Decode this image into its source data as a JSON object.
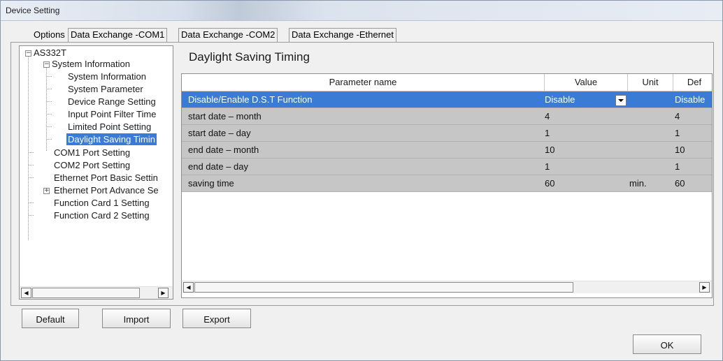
{
  "window": {
    "title": "Device Setting"
  },
  "tabs": [
    {
      "label": "Options"
    },
    {
      "label": "Data Exchange -COM1"
    },
    {
      "label": "Data Exchange -COM2"
    },
    {
      "label": "Data Exchange -Ethernet"
    }
  ],
  "tree": {
    "root": "AS332T",
    "group": "System Information",
    "children": [
      "System Information",
      "System Parameter",
      "Device Range Setting",
      "Input Point Filter Time",
      "Limited Point Setting",
      "Daylight Saving Timin"
    ],
    "top": [
      "COM1 Port Setting",
      "COM2 Port Setting",
      "Ethernet Port Basic Settin",
      "Ethernet Port Advance Se",
      "Function Card 1 Setting",
      "Function Card 2 Setting"
    ]
  },
  "panel": {
    "title": "Daylight Saving Timing"
  },
  "grid": {
    "headers": [
      "Parameter name",
      "Value",
      "Unit",
      "Def"
    ],
    "rows": [
      {
        "name": "Disable/Enable D.S.T Function",
        "value": "Disable",
        "unit": "",
        "default": "Disable"
      },
      {
        "name": "start date – month",
        "value": "4",
        "unit": "",
        "default": "4"
      },
      {
        "name": "start date – day",
        "value": "1",
        "unit": "",
        "default": "1"
      },
      {
        "name": "end date – month",
        "value": "10",
        "unit": "",
        "default": "10"
      },
      {
        "name": "end date – day",
        "value": "1",
        "unit": "",
        "default": "1"
      },
      {
        "name": "saving time",
        "value": "60",
        "unit": "min.",
        "default": "60"
      }
    ]
  },
  "buttons": {
    "default": "Default",
    "import": "Import",
    "export": "Export",
    "ok": "OK"
  },
  "colors": {
    "selection": "#3a7bd5",
    "row": "#c6c6c6",
    "title_bar": "#dbe3ee"
  }
}
